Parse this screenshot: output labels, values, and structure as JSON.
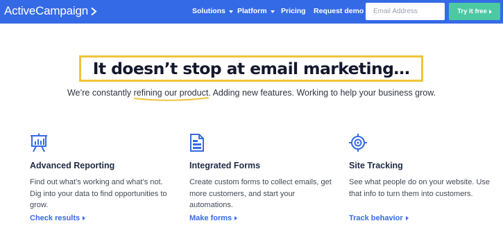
{
  "nav": {
    "logo_text": "ActiveCampaign",
    "logo_mark": "chevron-right",
    "items": [
      {
        "label": "Solutions",
        "has_dropdown": true
      },
      {
        "label": "Platform",
        "has_dropdown": true
      },
      {
        "label": "Pricing",
        "has_dropdown": false
      },
      {
        "label": "Request demo",
        "has_dropdown": false
      }
    ],
    "email_placeholder": "Email Address",
    "cta_label": "Try it free"
  },
  "hero": {
    "headline": "It doesn’t stop at email marketing…",
    "subtitle_before": "We’re constantly ",
    "subtitle_highlight": "refining our product",
    "subtitle_after": ". Adding new features. Working to help your business grow."
  },
  "features": [
    {
      "icon": "presentation-chart-icon",
      "title": "Advanced Reporting",
      "description": "Find out what’s working and what’s not. Dig into your data to find opportunities to grow.",
      "link": "Check results"
    },
    {
      "icon": "form-document-icon",
      "title": "Integrated Forms",
      "description": "Create custom forms to collect emails, get more customers, and start your automations.",
      "link": "Make forms"
    },
    {
      "icon": "crosshair-target-icon",
      "title": "Site Tracking",
      "description": "See what people do on your website. Use that info to turn them into customers.",
      "link": "Track behavior"
    }
  ],
  "colors": {
    "brand_blue": "#356ae6",
    "cta_green": "#4cc9a2",
    "highlight_yellow": "#f0c43a"
  }
}
